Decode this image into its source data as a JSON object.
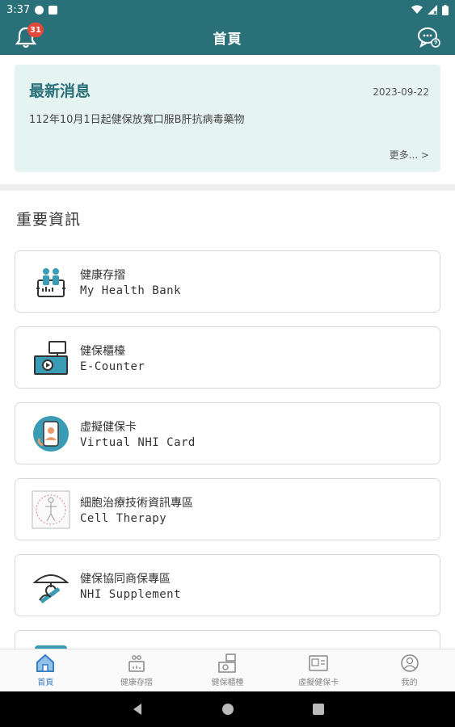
{
  "status_bar": {
    "time": "3:37"
  },
  "app_bar": {
    "title": "首頁",
    "notification_count": "31"
  },
  "news": {
    "heading": "最新消息",
    "date": "2023-09-22",
    "item": "112年10月1日起健保放寬口服B肝抗病毒藥物",
    "more": "更多... >"
  },
  "section": {
    "title": "重要資訊"
  },
  "tiles": [
    {
      "zh": "健康存摺",
      "en": "My Health Bank",
      "icon": "health-bank-icon"
    },
    {
      "zh": "健保櫃檯",
      "en": "E-Counter",
      "icon": "e-counter-icon"
    },
    {
      "zh": "虛擬健保卡",
      "en": "Virtual NHI Card",
      "icon": "virtual-card-icon"
    },
    {
      "zh": "細胞治療技術資訊專區",
      "en": "Cell Therapy",
      "icon": "cell-therapy-icon"
    },
    {
      "zh": "健保協同商保專區",
      "en": "NHI Supplement",
      "icon": "supplement-icon"
    }
  ],
  "bottom_nav": [
    {
      "label": "首頁",
      "icon": "home-icon",
      "active": true
    },
    {
      "label": "健康存摺",
      "icon": "health-bank-icon"
    },
    {
      "label": "健保櫃檯",
      "icon": "e-counter-icon"
    },
    {
      "label": "虛擬健保卡",
      "icon": "nhi-card-icon"
    },
    {
      "label": "我的",
      "icon": "profile-icon"
    }
  ],
  "colors": {
    "primary": "#2a7079",
    "accent": "#3a9bb5",
    "badge": "#e5483a",
    "nav_active": "#3a7cc4"
  }
}
